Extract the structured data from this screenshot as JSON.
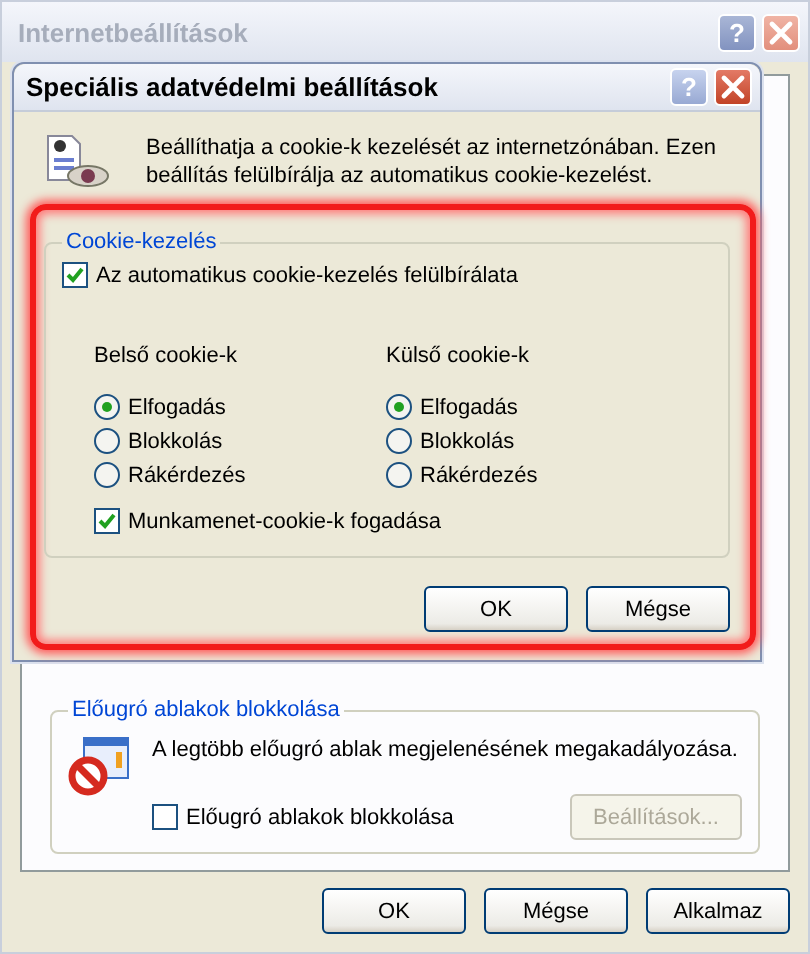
{
  "window": {
    "title": "Internetbeállítások",
    "help": "?"
  },
  "popup_group": {
    "title": "Előugró ablakok blokkolása",
    "description": "A legtöbb előugró ablak megjelenésének megakadályozása.",
    "checkbox": {
      "label": "Előugró ablakok blokkolása",
      "checked": false
    },
    "settings_button": {
      "label": "Beállítások...",
      "disabled": true
    }
  },
  "buttons": [
    "OK",
    "Mégse",
    "Alkalmaz"
  ],
  "dialog": {
    "title": "Speciális adatvédelmi beállítások",
    "help": "?",
    "intro": "Beállíthatja a cookie-k kezelését az internetzónában. Ezen beállítás felülbírálja az automatikus cookie-kezelést.",
    "group": {
      "title": "Cookie-kezelés",
      "override": {
        "label": "Az automatikus cookie-kezelés felülbírálata",
        "checked": true
      },
      "columns": [
        {
          "title": "Belső cookie-k",
          "options": [
            {
              "label": "Elfogadás",
              "selected": true
            },
            {
              "label": "Blokkolás",
              "selected": false
            },
            {
              "label": "Rákérdezés",
              "selected": false
            }
          ]
        },
        {
          "title": "Külső cookie-k",
          "options": [
            {
              "label": "Elfogadás",
              "selected": true
            },
            {
              "label": "Blokkolás",
              "selected": false
            },
            {
              "label": "Rákérdezés",
              "selected": false
            }
          ]
        }
      ],
      "session": {
        "label": "Munkamenet-cookie-k fogadása",
        "checked": true
      }
    },
    "buttons": [
      "OK",
      "Mégse"
    ]
  }
}
